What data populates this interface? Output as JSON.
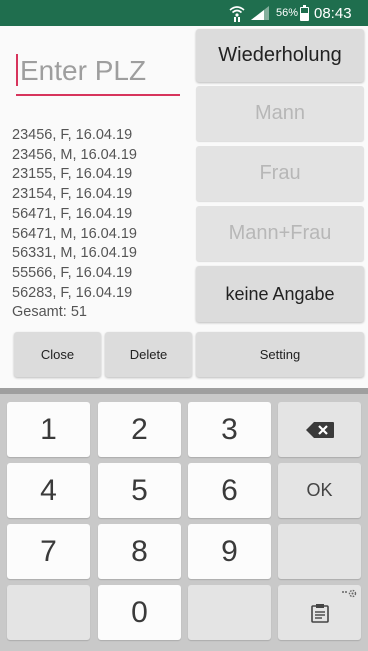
{
  "status_bar": {
    "battery_text": "56%",
    "battery_level": 0.56,
    "time": "08:43",
    "icons": [
      "wifi-icon",
      "signal-icon",
      "battery-icon"
    ]
  },
  "plz_input": {
    "placeholder": "Enter PLZ",
    "value": "",
    "accent_color": "#d7345c"
  },
  "entries": [
    "23456, F, 16.04.19",
    "23456, M, 16.04.19",
    "23155, F, 16.04.19",
    "23154, F, 16.04.19",
    "56471, F, 16.04.19",
    "56471, M, 16.04.19",
    "56331, M, 16.04.19",
    "55566, F, 16.04.19",
    "56283, F, 16.04.19"
  ],
  "total": "Gesamt: 51",
  "buttons": {
    "wiederholung": "Wiederholung",
    "mann": "Mann",
    "frau": "Frau",
    "mann_frau": "Mann+Frau",
    "keine_angabe": "keine Angabe",
    "close": "Close",
    "delete": "Delete",
    "setting": "Setting"
  },
  "keyboard": {
    "keys": [
      "1",
      "2",
      "3",
      "4",
      "5",
      "6",
      "7",
      "8",
      "9",
      "0"
    ],
    "ok": "OK",
    "backspace_icon": "backspace-icon",
    "clipboard_icon": "clipboard-icon",
    "settings_icon": "gear-icon"
  },
  "colors": {
    "status_bar": "#1f6e4e",
    "accent": "#d7345c"
  }
}
